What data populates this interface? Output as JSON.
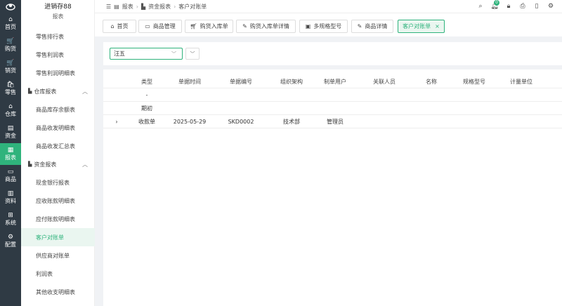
{
  "app": {
    "title": "进销存88",
    "submenu_heading": "报表"
  },
  "rail": [
    {
      "label": "首页",
      "icon": "home-icon",
      "glyph": "⌂"
    },
    {
      "label": "购货",
      "icon": "cart-icon",
      "glyph": "🛒"
    },
    {
      "label": "销货",
      "icon": "cart-out-icon",
      "glyph": "🛒"
    },
    {
      "label": "零售",
      "icon": "bag-icon",
      "glyph": "🛍"
    },
    {
      "label": "仓库",
      "icon": "warehouse-icon",
      "glyph": "⌂"
    },
    {
      "label": "资金",
      "icon": "wallet-icon",
      "glyph": "▤"
    },
    {
      "label": "报表",
      "icon": "report-icon",
      "glyph": "▦"
    },
    {
      "label": "商品",
      "icon": "box-icon",
      "glyph": "▭"
    },
    {
      "label": "资料",
      "icon": "data-icon",
      "glyph": "▥"
    },
    {
      "label": "系统",
      "icon": "grid-icon",
      "glyph": "⊞"
    },
    {
      "label": "配置",
      "icon": "gear-icon",
      "glyph": "⚙"
    }
  ],
  "submenu": {
    "items_top": [
      "零售排行表",
      "零售利润表",
      "零售利润明细表"
    ],
    "group_warehouse": "仓库报表",
    "items_warehouse": [
      "商品库存余额表",
      "商品收发明细表",
      "商品收发汇总表"
    ],
    "group_finance": "资金报表",
    "items_finance": [
      "现金银行报表",
      "应收账款明细表",
      "应付账款明细表",
      "客户对账单",
      "供应商对账单",
      "利润表",
      "其他收支明细表"
    ]
  },
  "breadcrumb": [
    "报表",
    "资金报表",
    "客户对账单"
  ],
  "tabs": [
    {
      "label": "首页"
    },
    {
      "label": "商品管理"
    },
    {
      "label": "购货入库单"
    },
    {
      "label": "购货入库单详情"
    },
    {
      "label": "多规格型号"
    },
    {
      "label": "商品详情"
    },
    {
      "label": "客户对账单",
      "close": "×"
    }
  ],
  "header": {
    "notification_count": "0"
  },
  "filter": {
    "customer_value": "汪五"
  },
  "table": {
    "columns": [
      "类型",
      "单据时间",
      "单据编号",
      "组织架构",
      "制单用户",
      "关联人员",
      "名称",
      "规格型号",
      "计量单位"
    ],
    "rows": [
      {
        "expand": "",
        "cells": [
          "-",
          "",
          "",
          "",
          "",
          "",
          "",
          "",
          ""
        ]
      },
      {
        "expand": "",
        "cells": [
          "期初",
          "",
          "",
          "",
          "",
          "",
          "",
          "",
          ""
        ]
      },
      {
        "expand": "›",
        "cells": [
          "收款单",
          "2025-05-29",
          "SKD0002",
          "技术部",
          "管理员",
          "",
          "",
          "",
          ""
        ]
      }
    ]
  },
  "colors": {
    "accent": "#2fb37c",
    "rail_bg": "#2f3a44"
  }
}
